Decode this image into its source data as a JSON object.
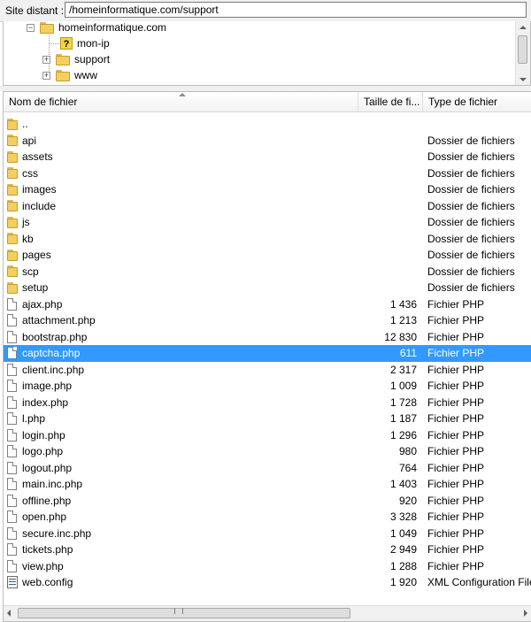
{
  "remote": {
    "label": "Site distant :",
    "path": "/homeinformatique.com/support"
  },
  "tree": {
    "root": "homeinformatique.com",
    "children": [
      {
        "label": "mon-ip"
      },
      {
        "label": "support"
      },
      {
        "label": "www"
      }
    ]
  },
  "columns": {
    "name": "Nom de fichier",
    "size": "Taille de fi...",
    "type": "Type de fichier"
  },
  "files": [
    {
      "name": "..",
      "size": "",
      "type": "",
      "icon": "folder"
    },
    {
      "name": "api",
      "size": "",
      "type": "Dossier de fichiers",
      "icon": "folder"
    },
    {
      "name": "assets",
      "size": "",
      "type": "Dossier de fichiers",
      "icon": "folder"
    },
    {
      "name": "css",
      "size": "",
      "type": "Dossier de fichiers",
      "icon": "folder"
    },
    {
      "name": "images",
      "size": "",
      "type": "Dossier de fichiers",
      "icon": "folder"
    },
    {
      "name": "include",
      "size": "",
      "type": "Dossier de fichiers",
      "icon": "folder"
    },
    {
      "name": "js",
      "size": "",
      "type": "Dossier de fichiers",
      "icon": "folder"
    },
    {
      "name": "kb",
      "size": "",
      "type": "Dossier de fichiers",
      "icon": "folder"
    },
    {
      "name": "pages",
      "size": "",
      "type": "Dossier de fichiers",
      "icon": "folder"
    },
    {
      "name": "scp",
      "size": "",
      "type": "Dossier de fichiers",
      "icon": "folder"
    },
    {
      "name": "setup",
      "size": "",
      "type": "Dossier de fichiers",
      "icon": "folder"
    },
    {
      "name": "ajax.php",
      "size": "1 436",
      "type": "Fichier PHP",
      "icon": "file"
    },
    {
      "name": "attachment.php",
      "size": "1 213",
      "type": "Fichier PHP",
      "icon": "file"
    },
    {
      "name": "bootstrap.php",
      "size": "12 830",
      "type": "Fichier PHP",
      "icon": "file"
    },
    {
      "name": "captcha.php",
      "size": "611",
      "type": "Fichier PHP",
      "icon": "file",
      "selected": true
    },
    {
      "name": "client.inc.php",
      "size": "2 317",
      "type": "Fichier PHP",
      "icon": "file"
    },
    {
      "name": "image.php",
      "size": "1 009",
      "type": "Fichier PHP",
      "icon": "file"
    },
    {
      "name": "index.php",
      "size": "1 728",
      "type": "Fichier PHP",
      "icon": "file"
    },
    {
      "name": "l.php",
      "size": "1 187",
      "type": "Fichier PHP",
      "icon": "file"
    },
    {
      "name": "login.php",
      "size": "1 296",
      "type": "Fichier PHP",
      "icon": "file"
    },
    {
      "name": "logo.php",
      "size": "980",
      "type": "Fichier PHP",
      "icon": "file"
    },
    {
      "name": "logout.php",
      "size": "764",
      "type": "Fichier PHP",
      "icon": "file"
    },
    {
      "name": "main.inc.php",
      "size": "1 403",
      "type": "Fichier PHP",
      "icon": "file"
    },
    {
      "name": "offline.php",
      "size": "920",
      "type": "Fichier PHP",
      "icon": "file"
    },
    {
      "name": "open.php",
      "size": "3 328",
      "type": "Fichier PHP",
      "icon": "file"
    },
    {
      "name": "secure.inc.php",
      "size": "1 049",
      "type": "Fichier PHP",
      "icon": "file"
    },
    {
      "name": "tickets.php",
      "size": "2 949",
      "type": "Fichier PHP",
      "icon": "file"
    },
    {
      "name": "view.php",
      "size": "1 288",
      "type": "Fichier PHP",
      "icon": "file"
    },
    {
      "name": "web.config",
      "size": "1 920",
      "type": "XML Configuration File",
      "icon": "config"
    }
  ],
  "colors": {
    "selection": "#3399ff",
    "folder": "#f3cf60"
  }
}
